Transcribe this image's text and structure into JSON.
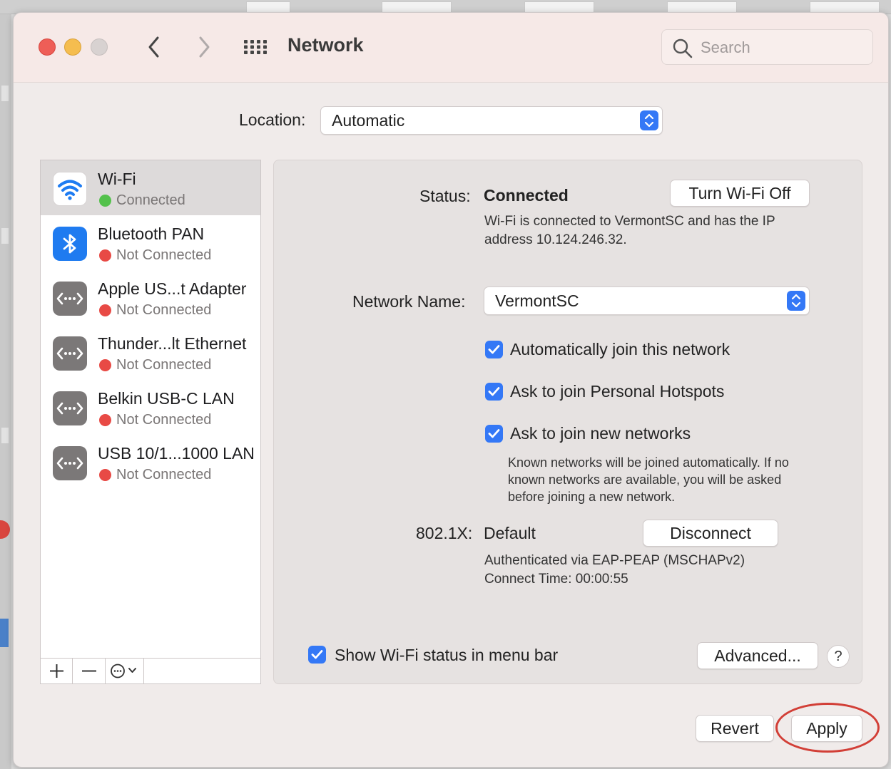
{
  "window": {
    "title": "Network",
    "search_placeholder": "Search"
  },
  "location": {
    "label": "Location:",
    "value": "Automatic"
  },
  "services": [
    {
      "name": "Wi-Fi",
      "status": "Connected",
      "status_color": "#53c14b",
      "icon": "wifi-icon",
      "selected": true
    },
    {
      "name": "Bluetooth PAN",
      "status": "Not Connected",
      "status_color": "#e84a45",
      "icon": "bluetooth-icon"
    },
    {
      "name": "Apple US...t Adapter",
      "status": "Not Connected",
      "status_color": "#e84a45",
      "icon": "ethernet-icon"
    },
    {
      "name": "Thunder...lt Ethernet",
      "status": "Not Connected",
      "status_color": "#e84a45",
      "icon": "ethernet-icon"
    },
    {
      "name": "Belkin USB-C LAN",
      "status": "Not Connected",
      "status_color": "#e84a45",
      "icon": "ethernet-icon"
    },
    {
      "name": "USB 10/1...1000 LAN",
      "status": "Not Connected",
      "status_color": "#e84a45",
      "icon": "ethernet-icon"
    }
  ],
  "sidebar_footer": {
    "add": "+",
    "remove": "−"
  },
  "detail": {
    "status_label": "Status:",
    "status_value": "Connected",
    "toggle_button": "Turn Wi-Fi Off",
    "status_desc": "Wi-Fi is connected to VermontSC and has the IP address 10.124.246.32.",
    "network_name_label": "Network Name:",
    "network_name_value": "VermontSC",
    "checkboxes": [
      {
        "label": "Automatically join this network",
        "checked": true
      },
      {
        "label": "Ask to join Personal Hotspots",
        "checked": true
      },
      {
        "label": "Ask to join new networks",
        "checked": true
      }
    ],
    "new_networks_desc": "Known networks will be joined automatically. If no known networks are available, you will be asked before joining a new network.",
    "dot1x_label": "802.1X:",
    "dot1x_value": "Default",
    "disconnect_button": "Disconnect",
    "auth_desc_line1": "Authenticated via EAP-PEAP (MSCHAPv2)",
    "auth_desc_line2": "Connect Time: 00:00:55",
    "show_status_label": "Show Wi-Fi status in menu bar",
    "show_status_checked": true,
    "advanced_button": "Advanced...",
    "help_button": "?"
  },
  "footer": {
    "revert_button": "Revert",
    "apply_button": "Apply"
  },
  "colors": {
    "accent": "#3478f6",
    "connected": "#53c14b",
    "not_connected": "#e84a45",
    "highlight_ring": "#d23f37"
  }
}
